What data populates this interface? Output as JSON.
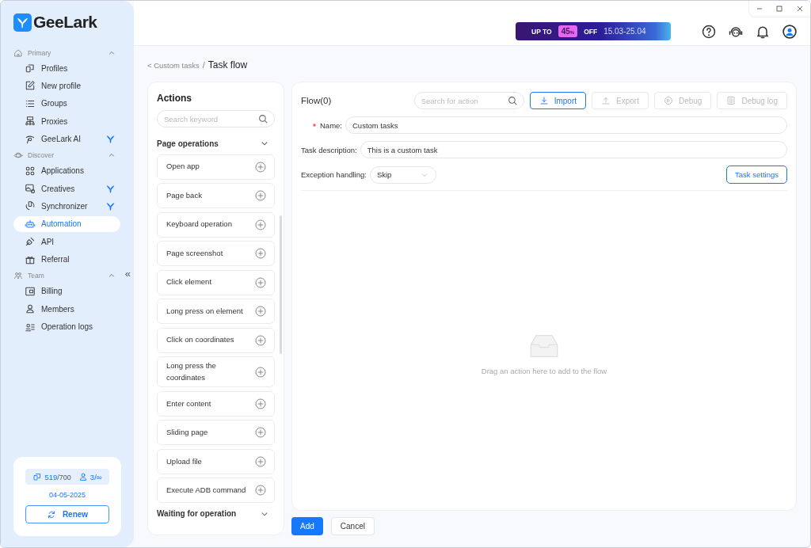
{
  "app": {
    "logo": "GeeLark"
  },
  "sidebar": {
    "sections": [
      {
        "title": "Primary",
        "expanded": true,
        "items": [
          {
            "label": "Profiles",
            "selected": false,
            "badge": false
          },
          {
            "label": "New profile",
            "selected": false,
            "badge": false
          },
          {
            "label": "Groups",
            "selected": false,
            "badge": false
          },
          {
            "label": "Proxies",
            "selected": false,
            "badge": false
          },
          {
            "label": "GeeLark AI",
            "selected": false,
            "badge": true
          }
        ]
      },
      {
        "title": "Discover",
        "expanded": true,
        "items": [
          {
            "label": "Applications",
            "selected": false,
            "badge": false
          },
          {
            "label": "Creatives",
            "selected": false,
            "badge": true
          },
          {
            "label": "Synchronizer",
            "selected": false,
            "badge": true
          },
          {
            "label": "Automation",
            "selected": true,
            "badge": false
          },
          {
            "label": "API",
            "selected": false,
            "badge": false
          },
          {
            "label": "Referral",
            "selected": false,
            "badge": false
          }
        ]
      },
      {
        "title": "Team",
        "expanded": true,
        "items": [
          {
            "label": "Billing",
            "selected": false,
            "badge": false
          },
          {
            "label": "Members",
            "selected": false,
            "badge": false
          },
          {
            "label": "Operation logs",
            "selected": false,
            "badge": false
          }
        ]
      }
    ],
    "collapse": "«",
    "plan": {
      "profiles": "519",
      "profiles_max": "/700",
      "members": "3/∞",
      "date": "04-05-2025",
      "renew": "Renew"
    }
  },
  "promo": {
    "prefix": "UP TO",
    "percent": "45",
    "percent_sign": "%",
    "suffix": "OFF",
    "dates": "15.03-25.04"
  },
  "breadcrumb": {
    "parent": "< Custom tasks",
    "separator": "/",
    "current": "Task flow"
  },
  "actions": {
    "title": "Actions",
    "search": {
      "placeholder": "Search keyword"
    },
    "groups": [
      {
        "title": "Page operations",
        "expanded": true,
        "items": [
          "Open app",
          "Page back",
          "Keyboard operation",
          "Page screenshot",
          "Click element",
          "Long press on element",
          "Click on coordinates",
          "Long press the coordinates",
          "Enter content",
          "Sliding page",
          "Upload file",
          "Execute ADB command"
        ]
      },
      {
        "title": "Waiting for operation",
        "expanded": false
      }
    ]
  },
  "flow": {
    "title": "Flow(0)",
    "search": {
      "placeholder": "Search for action"
    },
    "buttons": [
      {
        "label": "Import",
        "disabled": false
      },
      {
        "label": "Export",
        "disabled": true
      },
      {
        "label": "Debug",
        "disabled": true
      },
      {
        "label": "Debug log",
        "disabled": true
      }
    ],
    "fields": [
      {
        "kind": "text",
        "label": "Name:",
        "required": true,
        "value": "Custom tasks"
      },
      {
        "kind": "text",
        "label": "Task description:",
        "required": false,
        "value": "This is a custom task"
      },
      {
        "kind": "select",
        "label": "Exception handling:",
        "required": false,
        "value": "Skip"
      }
    ],
    "task_settings": "Task settings",
    "empty": "Drag an action here to add to the flow"
  },
  "footer": {
    "add": "Add",
    "cancel": "Cancel"
  }
}
